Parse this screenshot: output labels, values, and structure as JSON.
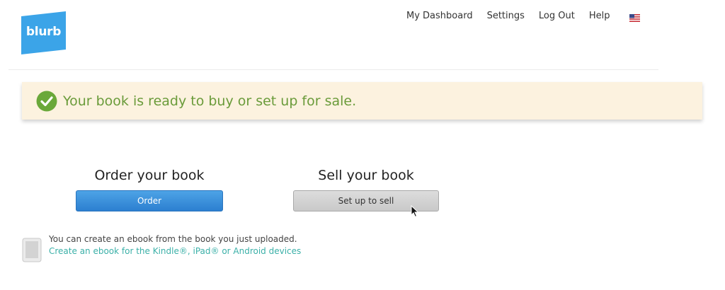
{
  "header": {
    "logo_text": "blurb",
    "nav": [
      {
        "label": "My Dashboard"
      },
      {
        "label": "Settings"
      },
      {
        "label": "Log Out"
      },
      {
        "label": "Help"
      }
    ],
    "flag_icon": "us-flag-icon"
  },
  "banner": {
    "message": "Your book is ready to buy or set up for sale.",
    "icon": "check-circle-icon",
    "background": "#fcf2df",
    "text_color": "#6a9b3a"
  },
  "order": {
    "title": "Order your book",
    "button_label": "Order",
    "button_color": "#2c7fd0"
  },
  "sell": {
    "title": "Sell your book",
    "button_label": "Set up to sell",
    "button_color": "#cfcfcf"
  },
  "ebook": {
    "icon": "tablet-icon",
    "text": "You can create an ebook from the book you just uploaded.",
    "link_label": "Create an ebook for the Kindle®, iPad® or Android devices",
    "link_color": "#3bb0a8"
  },
  "brand": {
    "logo_color": "#3ba4e8"
  }
}
